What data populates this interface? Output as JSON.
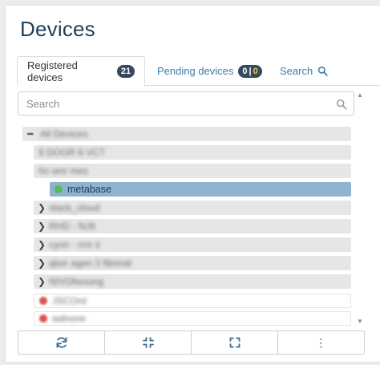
{
  "page": {
    "title": "Devices"
  },
  "tabs": [
    {
      "label": "Registered devices",
      "badge": "21",
      "active": true
    },
    {
      "label": "Pending devices",
      "badge_left": "0",
      "badge_sep": "|",
      "badge_right": "0",
      "active": false
    },
    {
      "label": "Search",
      "icon": "search-icon",
      "active": false
    }
  ],
  "search": {
    "placeholder": "Search",
    "value": ""
  },
  "tree": {
    "root": {
      "label": "All Devices",
      "icon": "minus-icon"
    },
    "rows": [
      {
        "label": "9 DOOR 6 VCT",
        "kind": "device"
      },
      {
        "label": "ho wnr mes",
        "kind": "device"
      },
      {
        "label": "metabase",
        "kind": "device",
        "status": "online",
        "selected": true
      },
      {
        "label": "stack_cloud",
        "kind": "group",
        "icon": "chevron-right-icon"
      },
      {
        "label": "RHD - NJIt",
        "kind": "group",
        "icon": "chevron-right-icon"
      },
      {
        "label": "cyon - rrnr ir",
        "kind": "group",
        "icon": "chevron-right-icon"
      },
      {
        "label": "qbor agen 3 fibonal",
        "kind": "group",
        "icon": "chevron-right-icon"
      },
      {
        "label": "NIVOfwoung",
        "kind": "group",
        "icon": "chevron-right-icon"
      },
      {
        "label": "JSCOrd",
        "kind": "device",
        "status": "offline"
      },
      {
        "label": "wdnone",
        "kind": "device",
        "status": "offline"
      }
    ]
  },
  "toolbar": {
    "buttons": [
      {
        "name": "refresh",
        "icon": "refresh-icon"
      },
      {
        "name": "collapse",
        "icon": "compress-icon"
      },
      {
        "name": "expand",
        "icon": "expand-icon"
      },
      {
        "name": "more",
        "icon": "more-vertical-icon",
        "glyph": "⋮"
      }
    ]
  },
  "colors": {
    "title": "#1f3f5b",
    "link": "#3d7eaa",
    "badge_bg": "#34495e",
    "badge_warn": "#f5c542",
    "selected_row": "#8fb3cf",
    "online": "#5cb85c",
    "offline": "#d9534f"
  }
}
